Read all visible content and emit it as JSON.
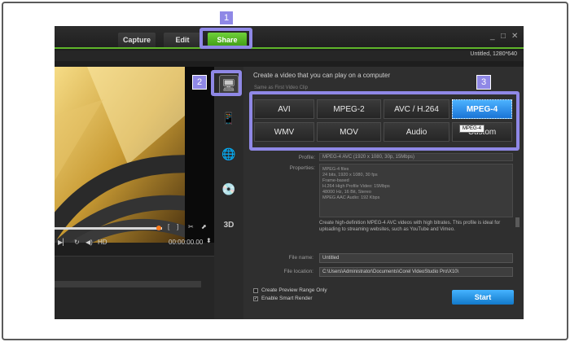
{
  "nav": {
    "capture": "Capture",
    "edit": "Edit",
    "share": "Share"
  },
  "window": {
    "minimize": "_",
    "restore": "□",
    "close": "✕"
  },
  "project_info": "Untitled, 1280*640",
  "player": {
    "mark_in": "[",
    "mark_out": "]",
    "hd_label": "HD",
    "timecode": "00:00:00.00"
  },
  "panel": {
    "heading": "Create a video that you can play on a computer",
    "same_as_first": "Same as First Video Clip",
    "formats_row1": [
      "AVI",
      "MPEG-2",
      "AVC / H.264",
      "MPEG-4"
    ],
    "formats_row2": [
      "WMV",
      "MOV",
      "Audio",
      "Custom"
    ],
    "tooltip": "MPEG-4",
    "profile_label": "Profile:",
    "profile_value": "MPEG-4 AVC (1920 x 1080, 30p, 15Mbps)",
    "properties_label": "Properties:",
    "properties": [
      "MPEG-4 files",
      "24 bits, 1920 x 1080, 30 fps",
      "Frame-based",
      "H.264 High Profile Video: 15Mbps",
      "48000 Hz, 16 Bit, Stereo",
      "MPEG AAC Audio: 192 Kbps"
    ],
    "description": "Create high-definition MPEG-4 AVC videos with high bitrates. This profile is ideal for uploading to streaming websites, such as YouTube and Vimeo.",
    "file_name_label": "File name:",
    "file_name_value": "Untitled",
    "file_location_label": "File location:",
    "file_location_value": "C:\\Users\\Administrator\\Documents\\Corel VideoStudio Pro\\X10\\",
    "preview_range_label": "Create Preview Range Only",
    "smart_render_label": "Enable Smart Render",
    "smart_render_checked": "✓",
    "start_label": "Start"
  },
  "callouts": [
    "1",
    "2",
    "3"
  ],
  "icons": {
    "computer": "monitor-icon",
    "device": "mobile-device-icon",
    "web": "globe-icon",
    "disc": "disc-icon",
    "3d": "3d-icon"
  },
  "colors": {
    "share_green": "#5fb52a",
    "mpeg4_blue": "#1a74d6",
    "callout": "#8f88e6",
    "start_blue": "#1279c9"
  }
}
